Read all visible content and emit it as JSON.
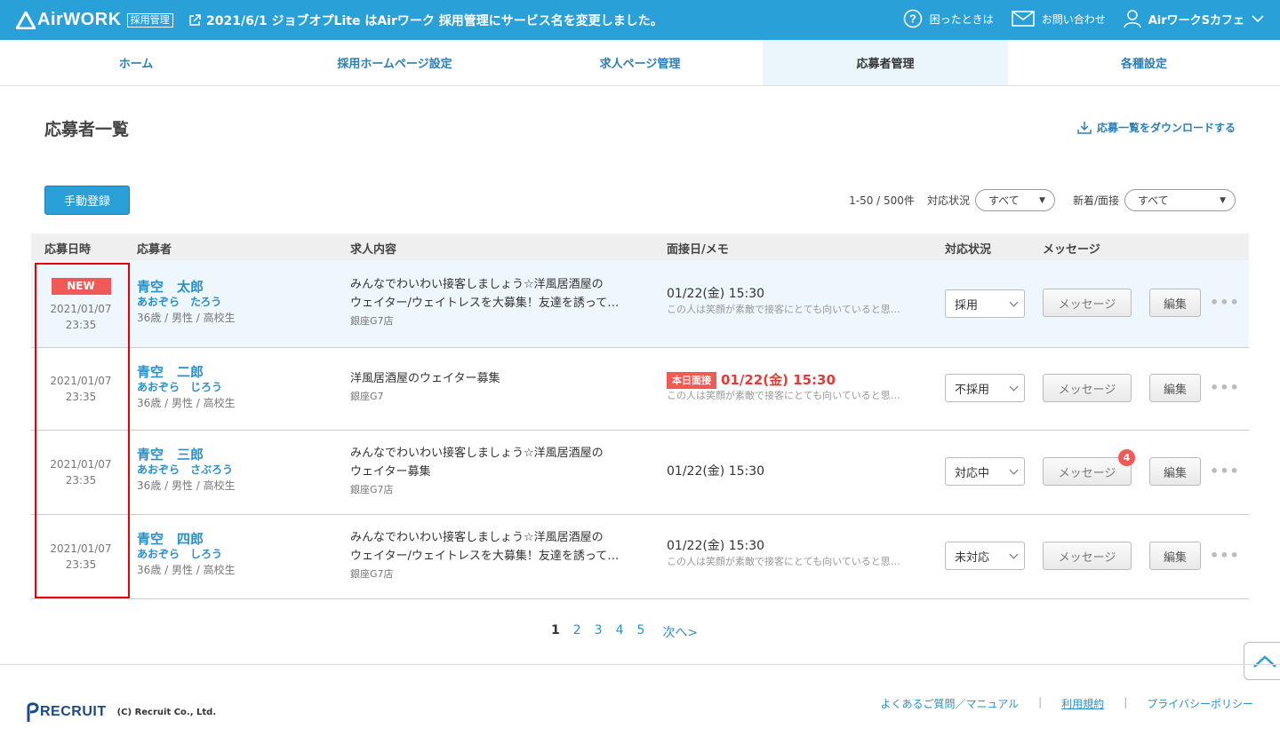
{
  "header": {
    "logo_text": "AirWORK",
    "logo_badge": "採用管理",
    "notice": "2021/6/1 ジョブオプLite はAirワーク 採用管理にサービス名を変更しました。",
    "help_label": "困ったときは",
    "contact_label": "お問い合わせ",
    "account_name": "AirワークSカフェ"
  },
  "nav": {
    "tabs": [
      {
        "label": "ホーム"
      },
      {
        "label": "採用ホームページ設定"
      },
      {
        "label": "求人ページ管理"
      },
      {
        "label": "応募者管理"
      },
      {
        "label": "各種設定"
      }
    ],
    "active": "応募者管理"
  },
  "page": {
    "title": "応募者一覧",
    "download_label": "応募一覧をダウンロードする",
    "manual_button": "手動登録",
    "count": "1-50 / 500件",
    "status_filter_label": "対応状況",
    "status_filter_value": "すべて",
    "type_filter_label": "新着/面接",
    "type_filter_value": "すべて"
  },
  "table": {
    "headers": [
      "応募日時",
      "応募者",
      "求人内容",
      "面接日/メモ",
      "対応状況",
      "メッセージ"
    ],
    "new_label": "NEW",
    "today_label": "本日面接",
    "message_button": "メッセージ",
    "edit_button": "編集",
    "more_label": "•••",
    "rows": [
      {
        "date": "2021/01/07",
        "time": "23:35",
        "name": "青空　太郎",
        "kana": "あおぞら　たろう",
        "meta": "36歳 / 男性 / 高校生",
        "job_line1": "みんなでわいわい接客しましょう☆洋風居酒屋の",
        "job_line2": "ウェイター/ウェイトレスを大募集！友達を誘って…",
        "shop": "銀座G7店",
        "interview": "01/22(金) 15:30",
        "memo": "この人は笑顔が素敵で接客にとても向いていると思…",
        "status": "採用"
      },
      {
        "date": "2021/01/07",
        "time": "23:35",
        "name": "青空　二郎",
        "kana": "あおぞら　じろう",
        "meta": "36歳 / 男性 / 高校生",
        "job_line1": "洋風居酒屋のウェイター募集",
        "job_line2": "",
        "shop": "銀座G7",
        "interview": "01/22(金) 15:30",
        "memo": "この人は笑顔が素敵で接客にとても向いていると思…",
        "status": "不採用"
      },
      {
        "date": "2021/01/07",
        "time": "23:35",
        "name": "青空　三郎",
        "kana": "あおぞら　さぶろう",
        "meta": "36歳 / 男性 / 高校生",
        "job_line1": "みんなでわいわい接客しましょう☆洋風居酒屋の",
        "job_line2": "ウェイター募集",
        "shop": "銀座G7店",
        "interview": "01/22(金) 15:30",
        "memo": "",
        "status": "対応中",
        "message_count": "4"
      },
      {
        "date": "2021/01/07",
        "time": "23:35",
        "name": "青空　四郎",
        "kana": "あおぞら　しろう",
        "meta": "36歳 / 男性 / 高校生",
        "job_line1": "みんなでわいわい接客しましょう☆洋風居酒屋の",
        "job_line2": "ウェイター/ウェイトレスを大募集！友達を誘って…",
        "shop": "銀座G7店",
        "interview": "01/22(金) 15:30",
        "memo": "この人は笑顔が素敵で接客にとても向いていると思…",
        "status": "未対応"
      }
    ]
  },
  "pagination": {
    "pages": [
      "1",
      "2",
      "3",
      "4",
      "5"
    ],
    "current": "1",
    "next_label": "次へ>"
  },
  "footer": {
    "logo_text": "RECRUIT",
    "copyright": "(C) Recruit Co., Ltd.",
    "links": [
      "よくあるご質問／マニュアル",
      "利用規約",
      "プライバシーポリシー"
    ]
  },
  "colors": {
    "brand": "#2aa0d9",
    "link": "#2b8fc9",
    "alert": "#f05a56",
    "highlight_row": "#eef7fd",
    "annotation_box": "#e00000"
  }
}
